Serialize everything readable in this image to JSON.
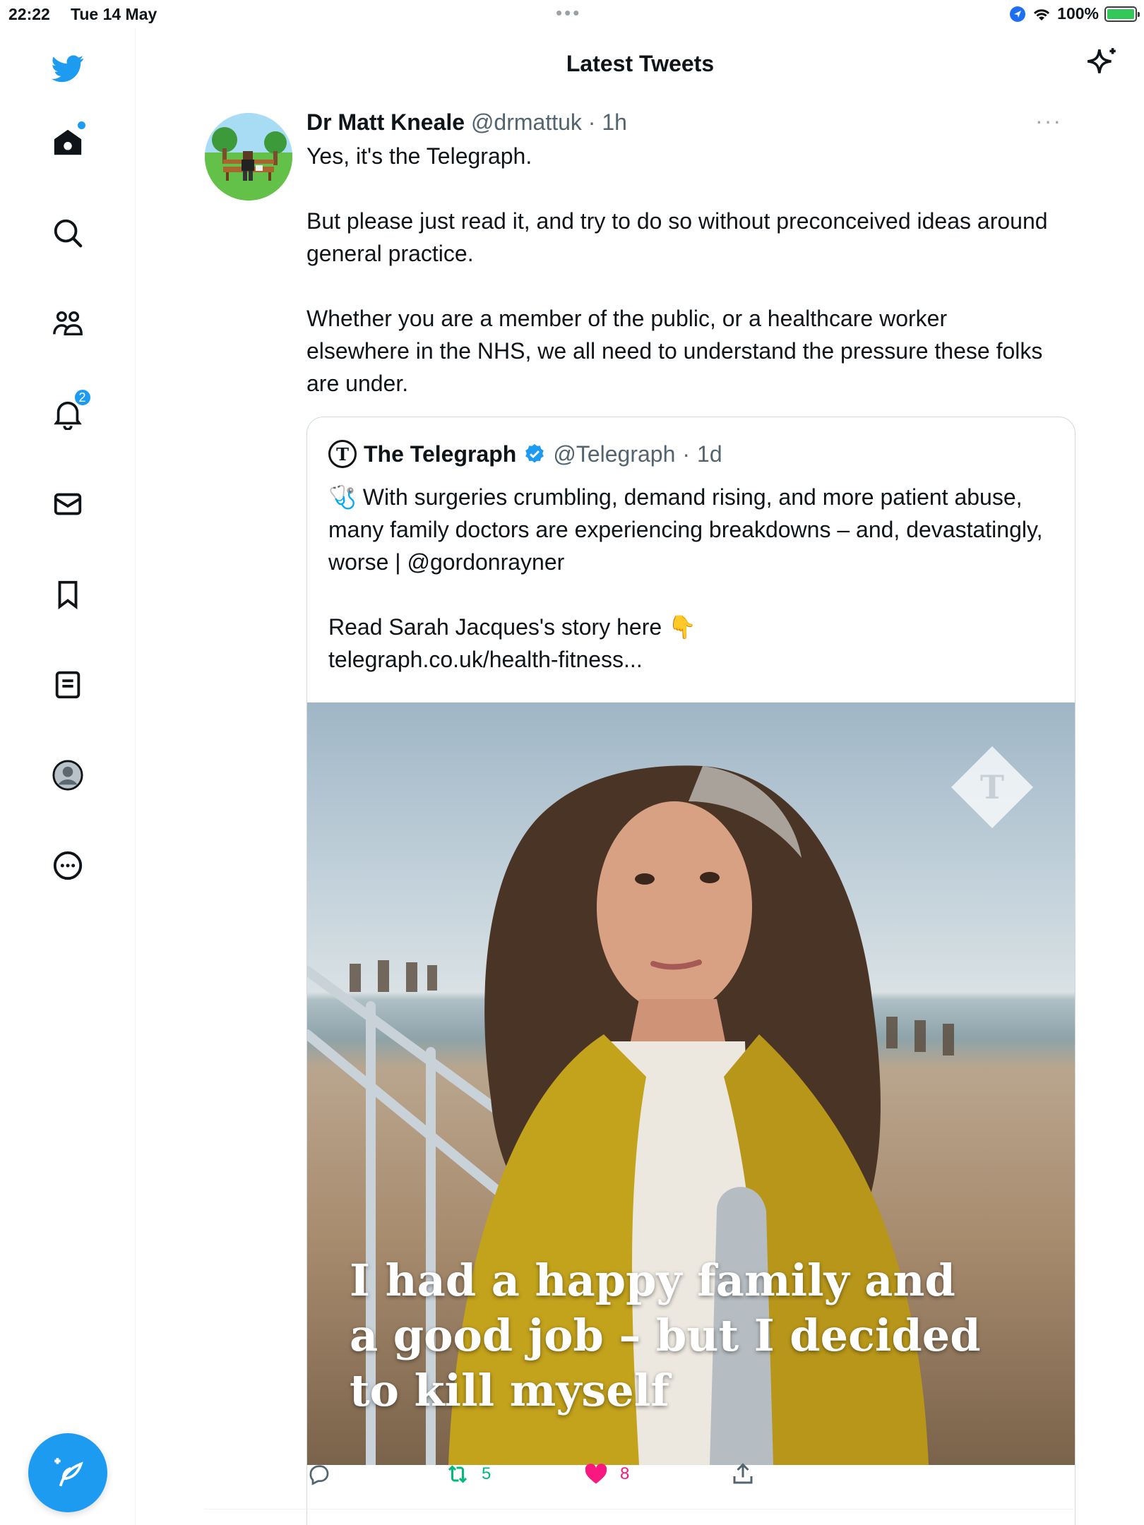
{
  "status_bar": {
    "time": "22:22",
    "date": "Tue 14 May",
    "battery": "100%"
  },
  "sidebar": {
    "items": [
      {
        "name": "home",
        "icon": "home-icon",
        "has_dot": true
      },
      {
        "name": "explore",
        "icon": "search-icon"
      },
      {
        "name": "communities",
        "icon": "communities-icon"
      },
      {
        "name": "notifications",
        "icon": "bell-icon",
        "badge": "2"
      },
      {
        "name": "messages",
        "icon": "mail-icon"
      },
      {
        "name": "bookmarks",
        "icon": "bookmark-icon"
      },
      {
        "name": "lists",
        "icon": "list-icon"
      },
      {
        "name": "profile",
        "icon": "profile-icon"
      },
      {
        "name": "more",
        "icon": "more-circle-icon"
      }
    ],
    "accent": "#1d9bf0"
  },
  "header": {
    "title": "Latest Tweets"
  },
  "tweet": {
    "name": "Dr Matt Kneale",
    "handle": "@drmattuk",
    "separator": "·",
    "time": "1h",
    "more": "···",
    "text": [
      "Yes, it's the Telegraph.",
      "",
      "But please just read it, and try to do so without preconceived ideas around general practice.",
      "",
      "Whether you are a member of the public, or a healthcare worker elsewhere in the NHS, we all need to understand the pressure these folks are under."
    ],
    "quote": {
      "logo": "T",
      "name": "The Telegraph",
      "handle": "@Telegraph",
      "separator": "·",
      "time": "1d",
      "text": [
        "🩺 With surgeries crumbling, demand rising, and more patient abuse, many family doctors are experiencing breakdowns – and, devastatingly, worse | @gordonrayner",
        "",
        "Read Sarah Jacques's story here 👇",
        "telegraph.co.uk/health-fitness..."
      ],
      "image_caption": "I had a happy family and a good job – but I decided to kill myself"
    },
    "actions": {
      "reply_count": "",
      "retweet_count": "5",
      "like_count": "8",
      "retweet_color": "#00ba7c",
      "like_color": "#f91880"
    }
  }
}
